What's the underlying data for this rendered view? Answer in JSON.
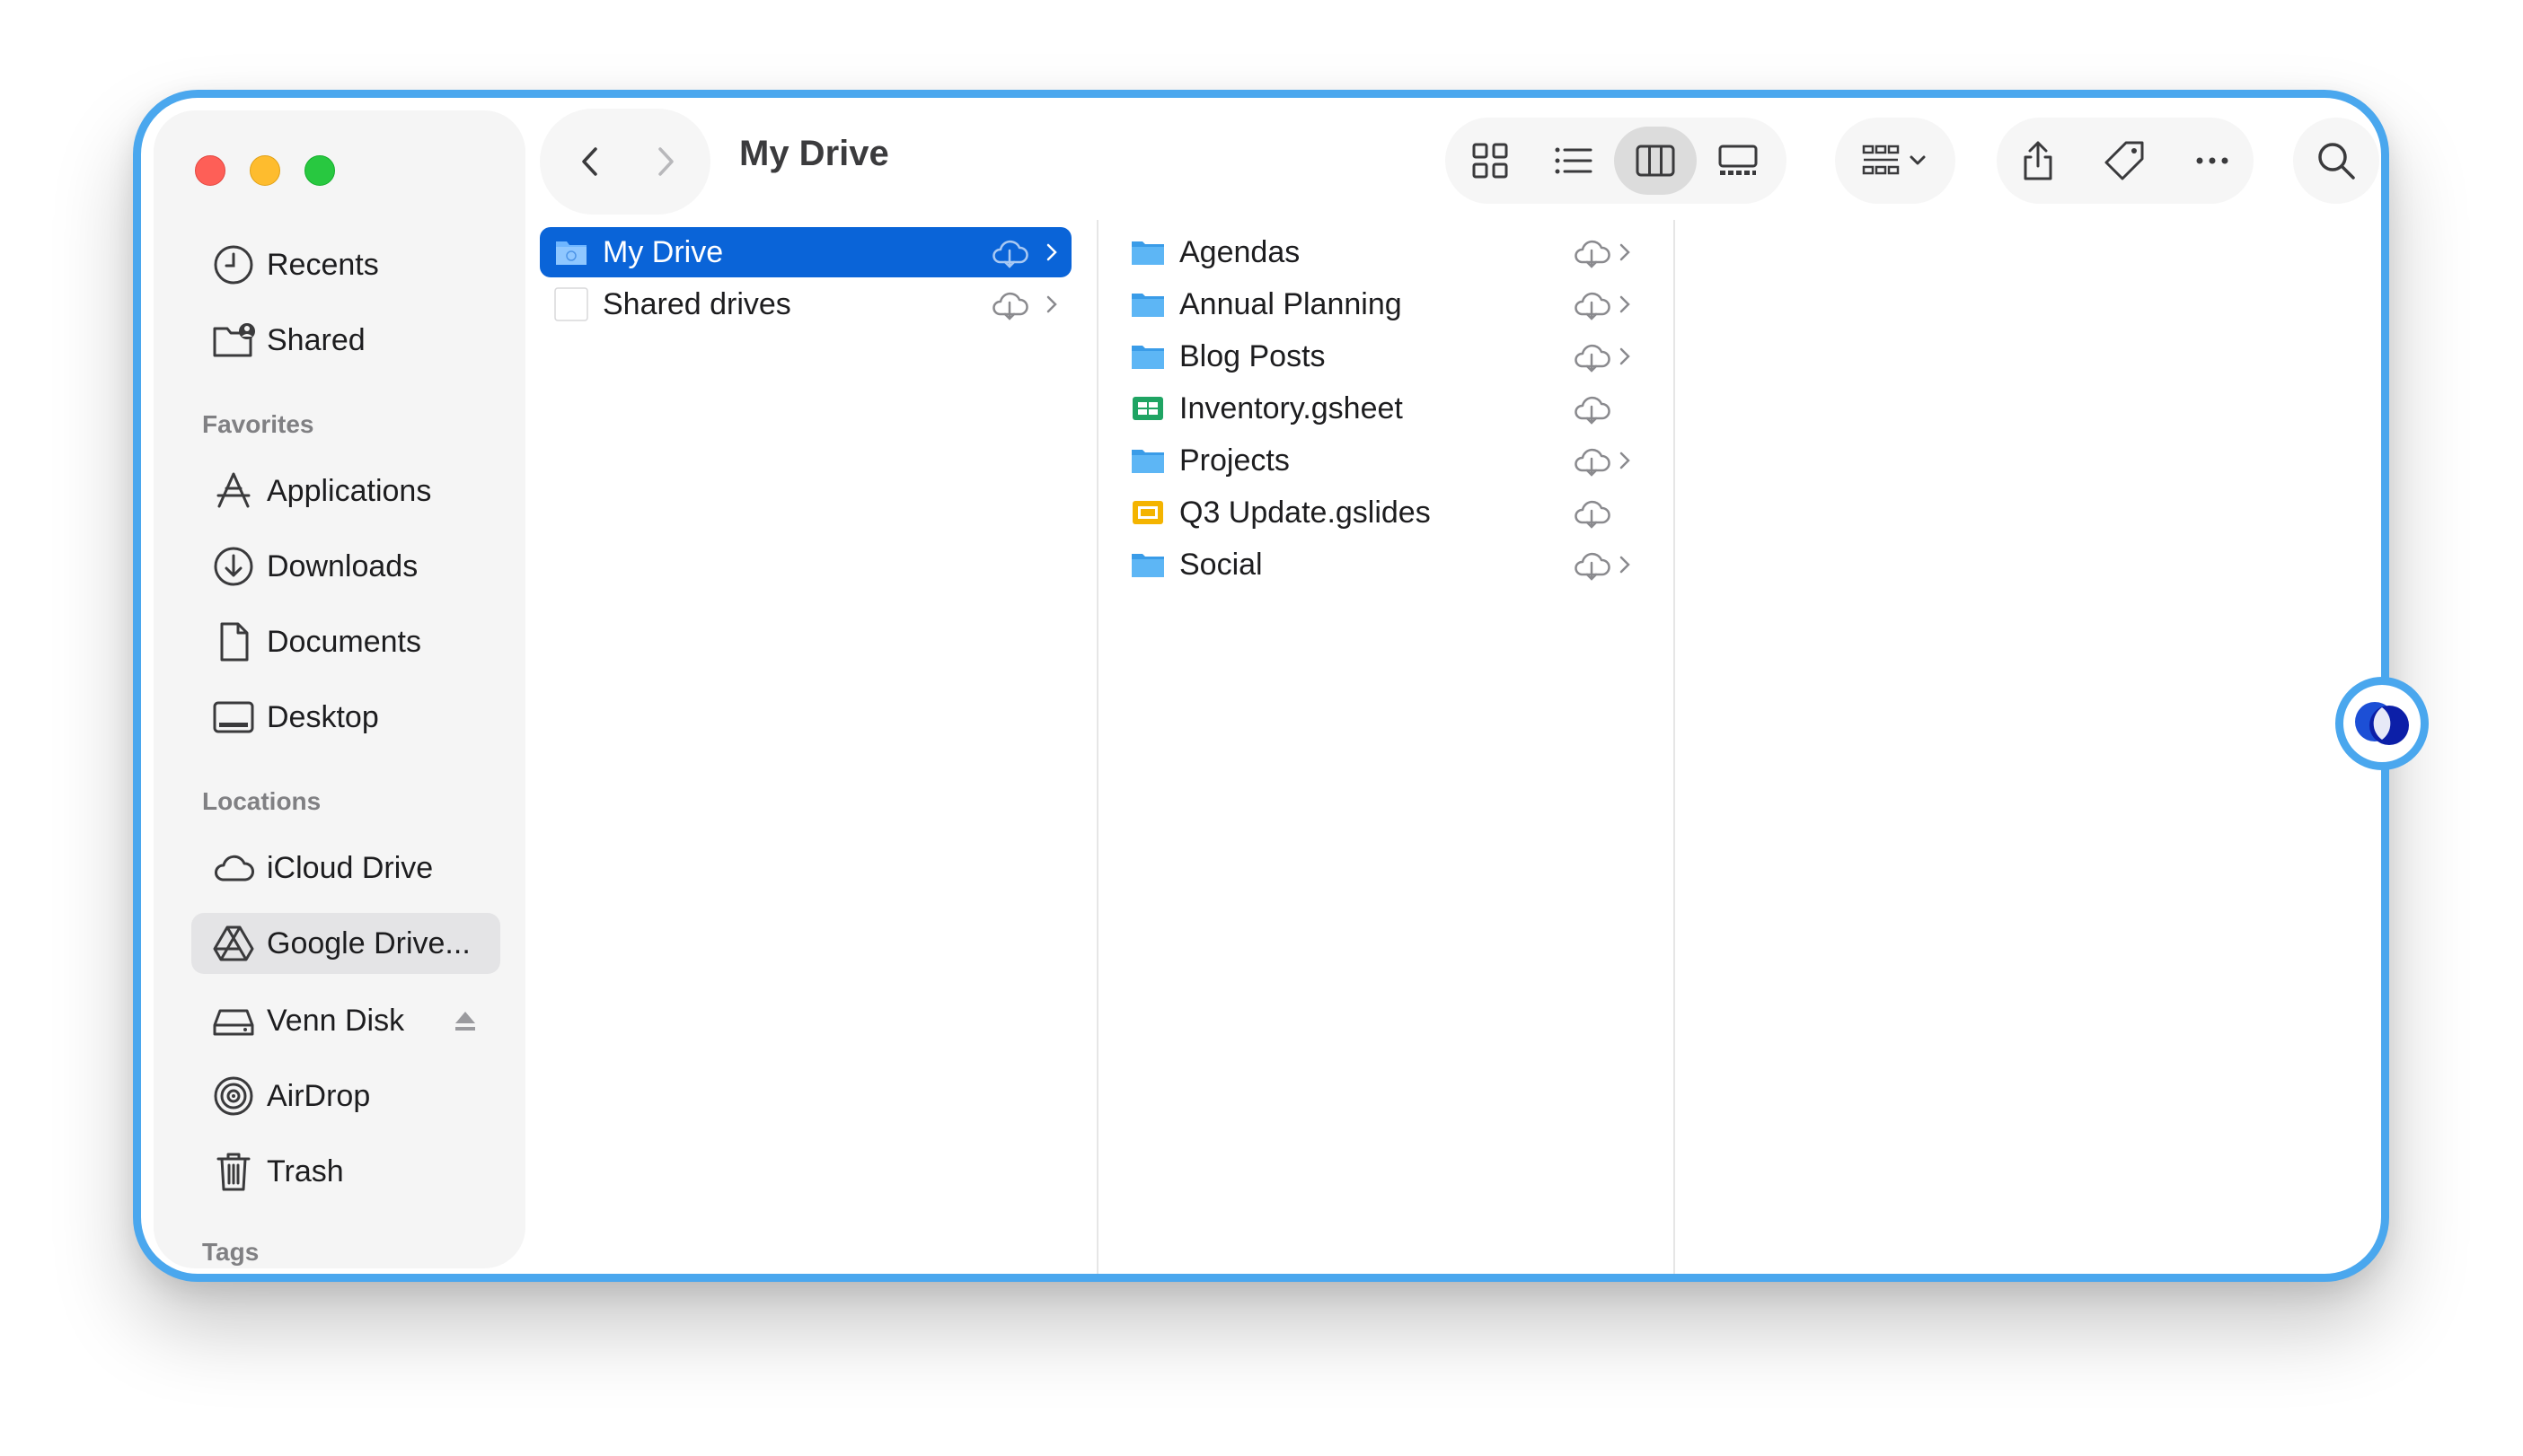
{
  "window": {
    "title": "My Drive"
  },
  "sidebar": {
    "top_items": [
      {
        "label": "Recents",
        "icon": "clock-icon"
      },
      {
        "label": "Shared",
        "icon": "shared-folder-icon"
      }
    ],
    "favorites_header": "Favorites",
    "favorites": [
      {
        "label": "Applications",
        "icon": "applications-icon"
      },
      {
        "label": "Downloads",
        "icon": "download-icon"
      },
      {
        "label": "Documents",
        "icon": "document-icon"
      },
      {
        "label": "Desktop",
        "icon": "desktop-icon"
      }
    ],
    "locations_header": "Locations",
    "locations": [
      {
        "label": "iCloud Drive",
        "icon": "cloud-icon"
      },
      {
        "label": "Google Drive...",
        "icon": "google-drive-icon",
        "active": true
      },
      {
        "label": "Venn Disk",
        "icon": "disk-icon",
        "eject": true
      },
      {
        "label": "AirDrop",
        "icon": "airdrop-icon"
      },
      {
        "label": "Trash",
        "icon": "trash-icon"
      }
    ],
    "tags_header": "Tags"
  },
  "column1": {
    "items": [
      {
        "label": "My Drive",
        "selected": true,
        "icon": "drive-folder-icon"
      },
      {
        "label": "Shared drives",
        "selected": false,
        "icon": "blank-file-icon"
      }
    ]
  },
  "column2": {
    "items": [
      {
        "label": "Agendas",
        "type": "folder",
        "has_children": true
      },
      {
        "label": "Annual Planning",
        "type": "folder",
        "has_children": true
      },
      {
        "label": "Blog Posts",
        "type": "folder",
        "has_children": true
      },
      {
        "label": "Inventory.gsheet",
        "type": "gsheet",
        "has_children": false
      },
      {
        "label": "Projects",
        "type": "folder",
        "has_children": true
      },
      {
        "label": "Q3 Update.gslides",
        "type": "gslides",
        "has_children": false
      },
      {
        "label": "Social",
        "type": "folder",
        "has_children": true
      }
    ]
  },
  "colors": {
    "selection": "#0a64d8",
    "window_border": "#4aa7ee",
    "folder": "#3ea6ee",
    "gsheet": "#1fa463",
    "gslides": "#f4b400"
  }
}
